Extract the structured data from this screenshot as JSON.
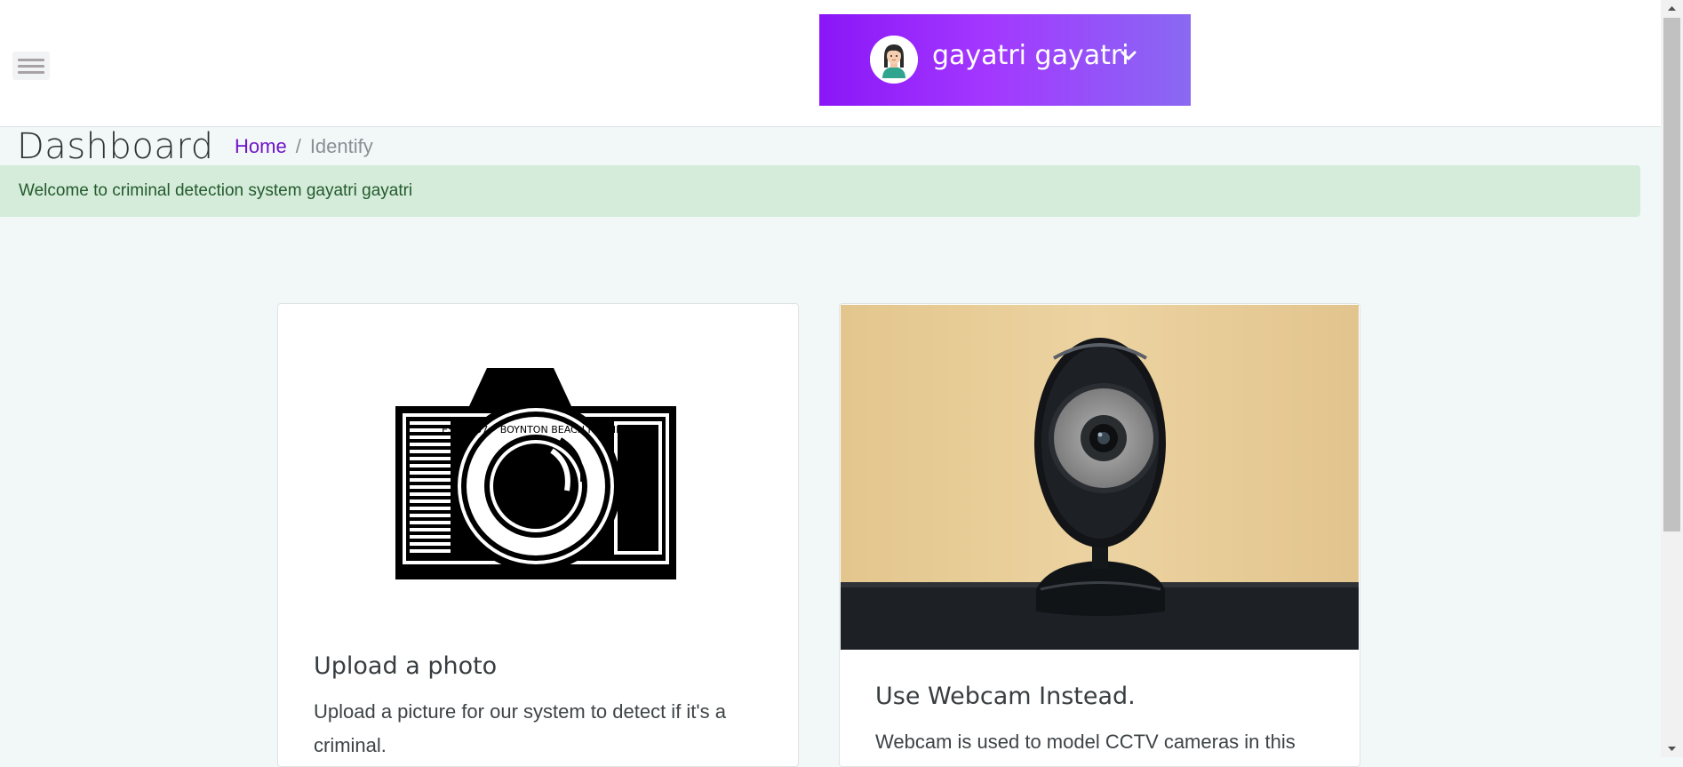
{
  "header": {
    "menu_icon": "hamburger-icon",
    "user": {
      "name": "gayatri gayatri",
      "avatar_icon": "user-avatar-icon",
      "dropdown_icon": "chevron-down-icon"
    },
    "accent_gradient": [
      "#8a16f7",
      "#8969f2"
    ]
  },
  "page": {
    "title": "Dashboard",
    "breadcrumb": {
      "home": "Home",
      "separator": "/",
      "current": "Identify"
    }
  },
  "alert": {
    "message": "Welcome to criminal detection system gayatri gayatri",
    "color": "#d4ecd9"
  },
  "cards": [
    {
      "title": "Upload a photo",
      "text": "Upload a picture for our system to detect if it's a criminal.",
      "image_icon": "camera-icon",
      "image_text_ring": "EST 2007 • BOYNTON BEACH FLORIDA"
    },
    {
      "title": "Use Webcam Instead.",
      "text": "Webcam is used to model CCTV cameras in this",
      "image_icon": "webcam-photo"
    }
  ]
}
